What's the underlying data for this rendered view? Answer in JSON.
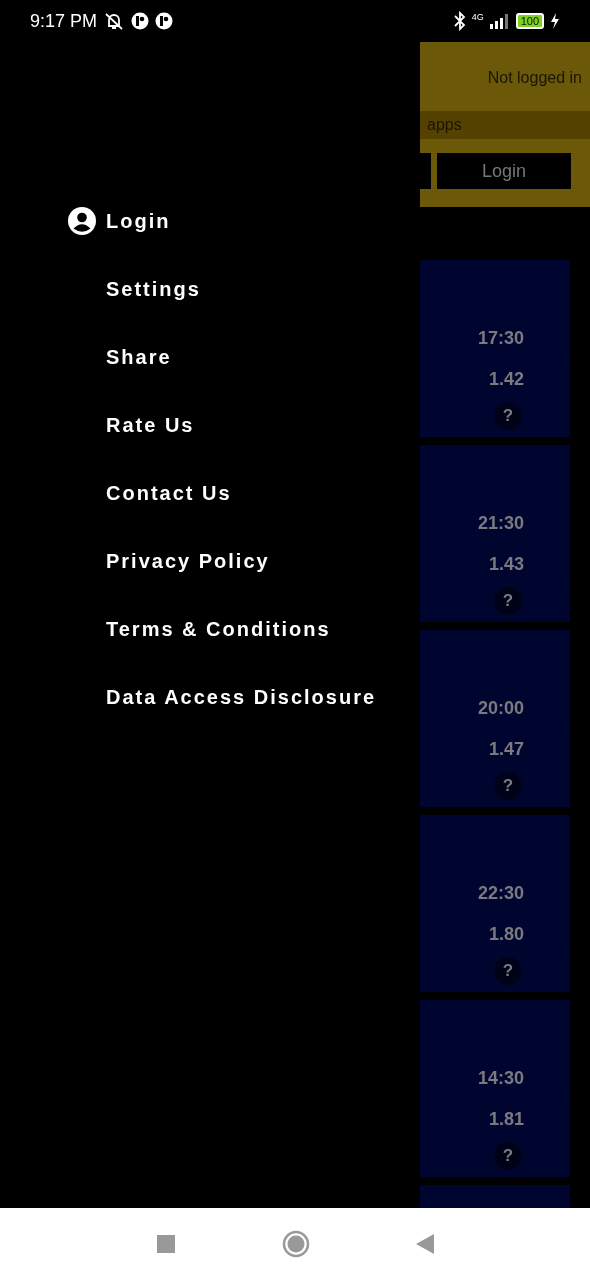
{
  "status_bar": {
    "time": "9:17 PM",
    "network": "4G",
    "battery": "100"
  },
  "drawer": {
    "items": [
      {
        "label": "Login",
        "kind": "account"
      },
      {
        "label": "Settings",
        "kind": "plain"
      },
      {
        "label": "Share",
        "kind": "plain"
      },
      {
        "label": "Rate Us",
        "kind": "plain"
      },
      {
        "label": "Contact Us",
        "kind": "plain"
      },
      {
        "label": "Privacy Policy",
        "kind": "plain"
      },
      {
        "label": "Terms & Conditions",
        "kind": "plain"
      },
      {
        "label": "Data Access Disclosure",
        "kind": "plain"
      }
    ]
  },
  "header": {
    "status": "Not logged in",
    "banner": "apps",
    "login_button": "Login"
  },
  "cards": [
    {
      "time": "17:30",
      "value": "1.42",
      "help": "?"
    },
    {
      "time": "21:30",
      "value": "1.43",
      "help": "?"
    },
    {
      "time": "20:00",
      "value": "1.47",
      "help": "?"
    },
    {
      "time": "22:30",
      "value": "1.80",
      "help": "?"
    },
    {
      "time": "14:30",
      "value": "1.81",
      "help": "?"
    }
  ]
}
